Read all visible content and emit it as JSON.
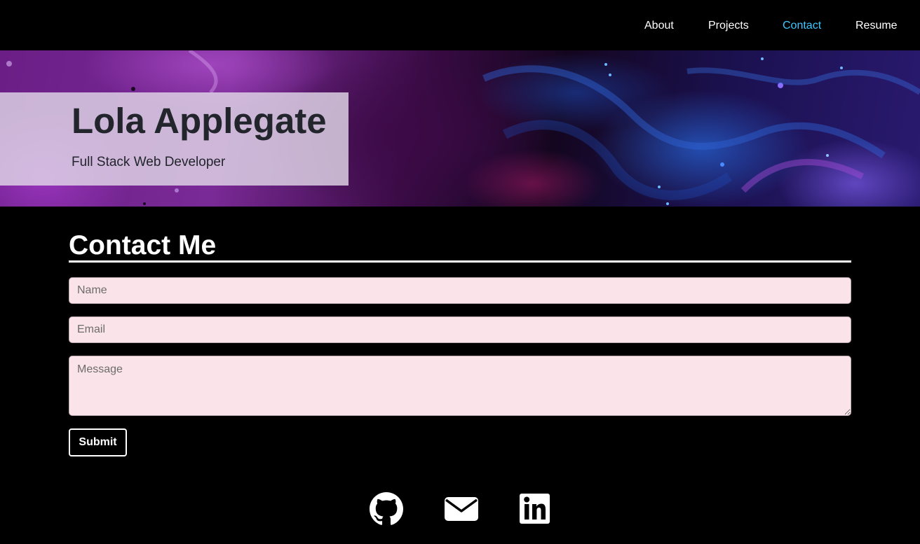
{
  "nav": {
    "items": [
      {
        "label": "About"
      },
      {
        "label": "Projects"
      },
      {
        "label": "Contact",
        "active": true
      },
      {
        "label": "Resume"
      }
    ],
    "active_color": "#3ec8ff"
  },
  "hero": {
    "name": "Lola Applegate",
    "role": "Full Stack Web Developer"
  },
  "contact": {
    "title": "Contact Me",
    "name_placeholder": "Name",
    "email_placeholder": "Email",
    "message_placeholder": "Message",
    "submit_label": "Submit",
    "field_background": "#fbe3ea"
  },
  "social": {
    "icons": [
      "github-icon",
      "envelope-icon",
      "linkedin-icon"
    ]
  }
}
